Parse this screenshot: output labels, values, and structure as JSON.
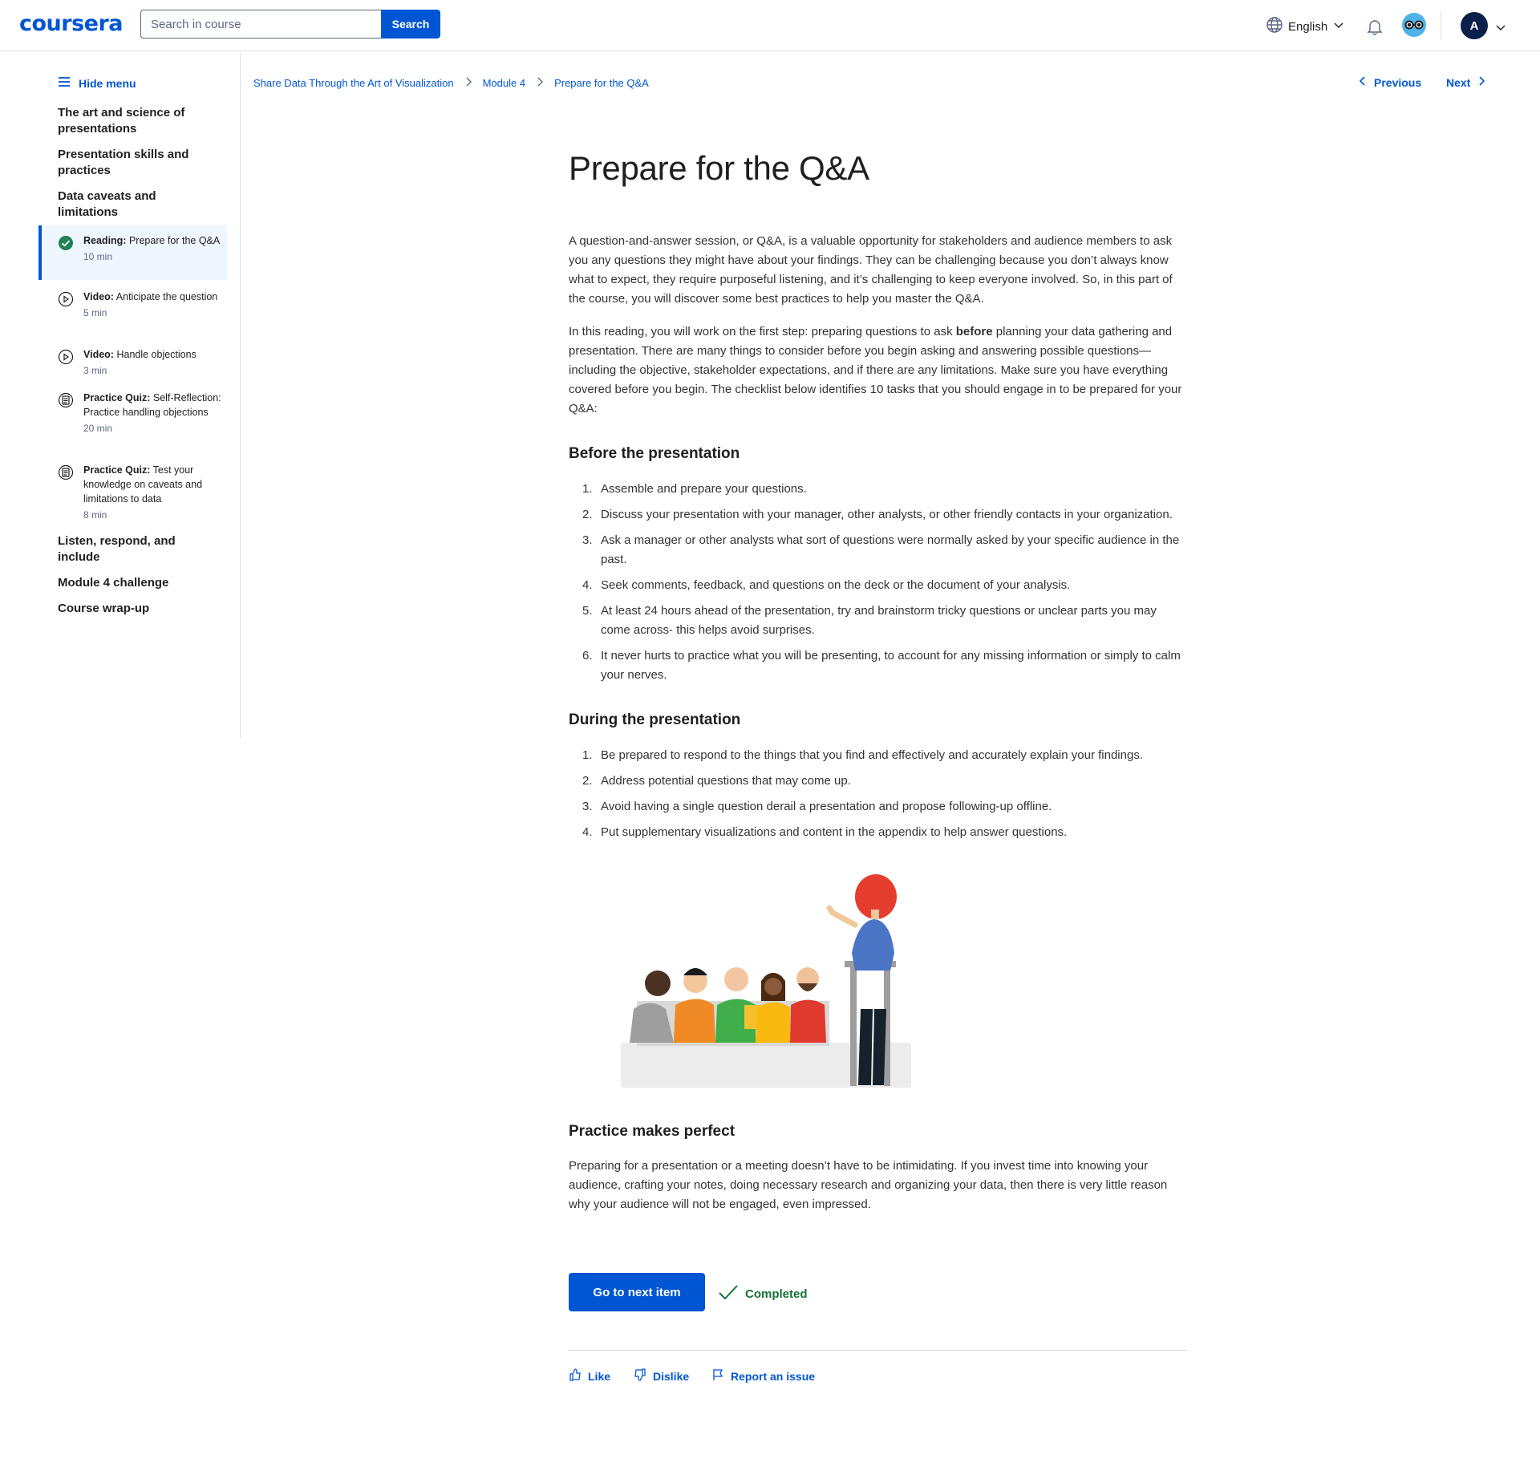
{
  "header": {
    "logo": "coursera",
    "search_placeholder": "Search in course",
    "search_button": "Search",
    "language": "English",
    "avatar_initial": "A"
  },
  "sidebar": {
    "hide_menu": "Hide menu",
    "sections": [
      "The art and science of presentations",
      "Presentation skills and practices",
      "Data caveats and limitations"
    ],
    "items": [
      {
        "type": "Reading:",
        "title": "Prepare for the Q&A",
        "duration": "10 min",
        "icon": "check-circle-icon",
        "active": true
      },
      {
        "type": "Video:",
        "title": "Anticipate the question",
        "duration": "5 min",
        "icon": "play-circle-icon"
      },
      {
        "type": "Video:",
        "title": "Handle objections",
        "duration": "3 min",
        "icon": "play-circle-icon"
      },
      {
        "type": "Practice Quiz:",
        "title": "Self-Reflection: Practice handling objections",
        "duration": "20 min",
        "icon": "quiz-icon"
      },
      {
        "type": "Practice Quiz:",
        "title": "Test your knowledge on caveats and limitations to data",
        "duration": "8 min",
        "icon": "quiz-icon"
      }
    ],
    "sections_after": [
      "Listen, respond, and include",
      "Module 4 challenge",
      "Course wrap-up"
    ]
  },
  "breadcrumb": [
    "Share Data Through the Art of Visualization",
    "Module 4",
    "Prepare for the Q&A"
  ],
  "nav": {
    "previous": "Previous",
    "next": "Next"
  },
  "main": {
    "title": "Prepare for the Q&A",
    "intro": "A question-and-answer session, or Q&A, is a valuable opportunity for stakeholders and audience members to ask you any questions they might have about your findings. They can be challenging because you don’t always know what to expect, they require purposeful listening, and it’s challenging to keep everyone involved. So, in this part of the course, you will discover some best practices to help you master the Q&A.",
    "para2_start": "In this reading, you will work on the first step: preparing questions to ask ",
    "para2_bold": "before",
    "para2_end": " planning your data gathering and presentation. There are many things to consider before you begin asking and answering possible questions—including the objective, stakeholder expectations, and if there are any limitations. Make sure you have everything covered before you begin. The checklist below identifies 10 tasks that you should engage in to be prepared for your Q&A:",
    "before_heading": "Before the presentation",
    "before_items": [
      "Assemble and prepare your questions.",
      "Discuss your presentation with your manager, other analysts, or other friendly contacts in your organization.",
      "Ask a manager or other analysts what sort of questions were normally asked by your specific audience in the past.",
      "Seek comments, feedback, and questions on the deck or the document of your analysis.",
      "At least 24 hours ahead of the presentation, try and brainstorm tricky questions or unclear parts you may come across- this helps avoid surprises.",
      "It never hurts to practice what you will be presenting, to account for any missing information or simply to calm your nerves."
    ],
    "during_heading": "During the presentation",
    "during_items": [
      "Be prepared to respond to the things that you find and effectively and accurately explain your findings.",
      "Address potential questions that may come up.",
      "Avoid having a single question derail a presentation and propose following-up offline.",
      "Put supplementary visualizations and content in the appendix to help answer questions."
    ],
    "practice_heading": "Practice makes perfect",
    "practice_text": "Preparing for a presentation or a meeting doesn’t have to be intimidating. If you invest time into knowing your audience, crafting your notes, doing necessary research and organizing your data, then there is very little reason why your audience will not be engaged, even impressed.",
    "next_item": "Go to next item",
    "completed": "Completed",
    "like": "Like",
    "dislike": "Dislike",
    "report": "Report an issue"
  },
  "colors": {
    "brand": "#0056d2",
    "success": "#137333"
  }
}
